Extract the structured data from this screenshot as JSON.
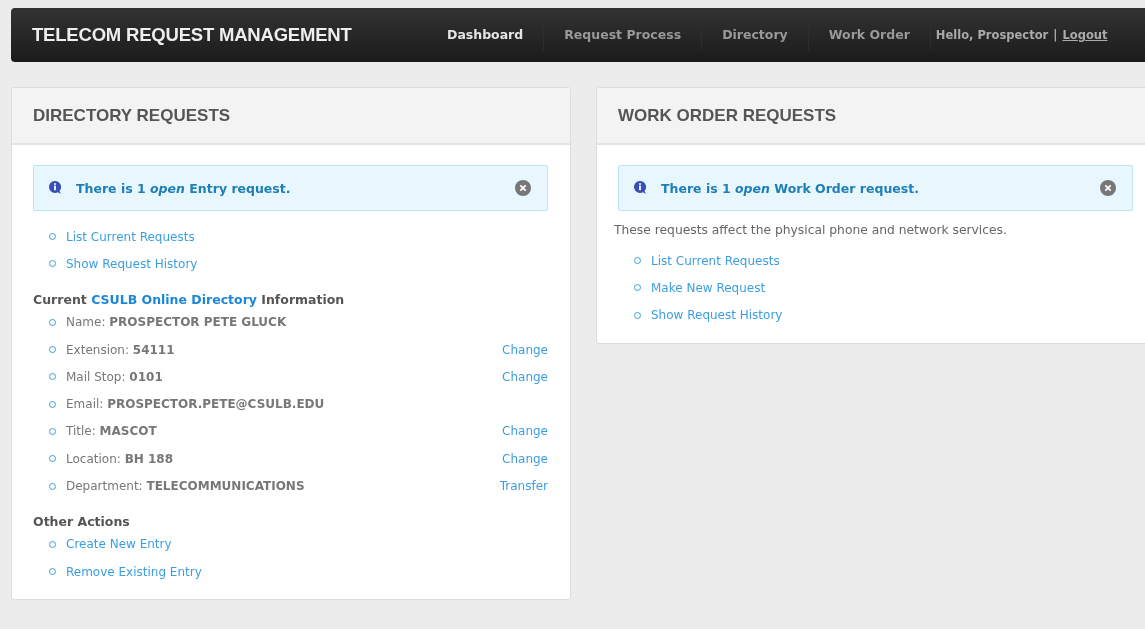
{
  "navbar": {
    "brand": "TELECOM REQUEST MANAGEMENT",
    "items": [
      {
        "label": "Dashboard",
        "selected": true
      },
      {
        "label": "Request Process",
        "selected": false
      },
      {
        "label": "Directory",
        "selected": false
      },
      {
        "label": "Work Order",
        "selected": false
      }
    ],
    "greeting": "Hello, Prospector",
    "separator": "|",
    "logout": "Logout"
  },
  "panels": [
    {
      "title": "DIRECTORY REQUESTS",
      "alert": "There is 1 *open* Entry request.",
      "sections": [
        {
          "links": [
            "List Current Requests",
            "Show Request History"
          ]
        },
        {
          "heading": {
            "before": "Current",
            "link": "CSULB Online Directory",
            "after": "Information"
          },
          "rows": [
            {
              "text": "Name: **PROSPECTOR PETE GLUCK**"
            },
            {
              "text": "Extension: **54111**",
              "action": "Change"
            },
            {
              "text": "Mail Stop: **0101**",
              "action": "Change"
            },
            {
              "text": "Email: **PROSPECTOR.PETE@CSULB.EDU**"
            },
            {
              "text": "Title: **MASCOT**",
              "action": "Change"
            },
            {
              "text": "Location: **BH 188**",
              "action": "Change"
            },
            {
              "text": "Department: **TELECOMMUNICATIONS**",
              "action": "Transfer"
            }
          ]
        },
        {
          "heading": {
            "before": "Other Actions"
          },
          "links": [
            "Create New Entry",
            "Remove Existing Entry"
          ]
        }
      ]
    },
    {
      "title": "WORK ORDER REQUESTS",
      "alert": "There is 1 *open* Work Order request.",
      "sections": [
        {
          "note": "These requests affect the physical phone and network services.",
          "links": [
            "List Current Requests",
            "Make New Request",
            "Show Request History"
          ]
        }
      ]
    }
  ]
}
